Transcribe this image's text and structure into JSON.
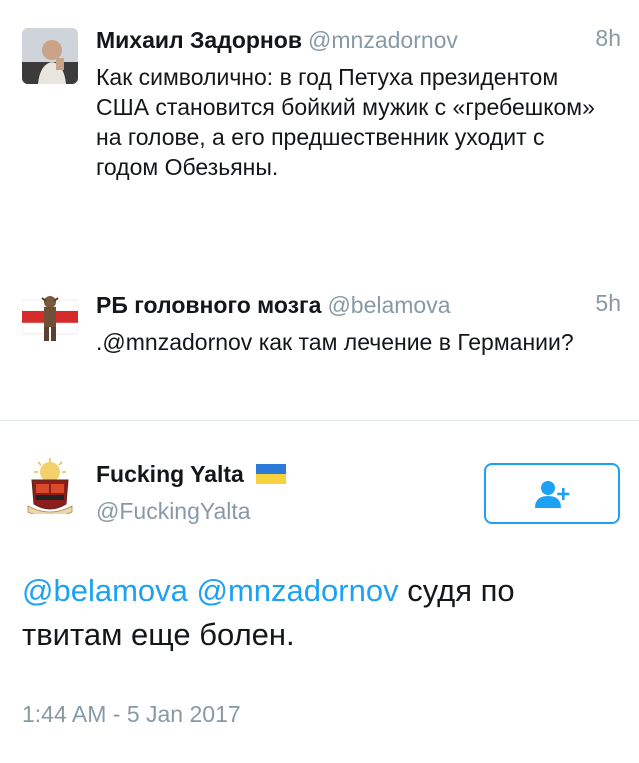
{
  "tweets": [
    {
      "name": "Михаил Задорнов",
      "handle": "@mnzadornov",
      "time": "8h",
      "text": "Как символично: в год Петуха президентом США становится бойкий мужик с «гребешком» на голове, а его предшественник уходит с годом Обезьяны."
    },
    {
      "name": "РБ головного мозга",
      "handle": "@belamova",
      "time": "5h",
      "text": ".@mnzadornov как там лечение в Германии?"
    }
  ],
  "main_tweet": {
    "name": "Fucking Yalta",
    "handle": "@FuckingYalta",
    "mention1": "@belamova",
    "mention2": "@mnzadornov",
    "text_rest": " судя по твитам еще болен.",
    "timestamp": "1:44 AM - 5 Jan 2017",
    "flag_icon": "ukraine-flag-icon",
    "follow_icon": "add-user-icon"
  },
  "colors": {
    "accent": "#1da1f2",
    "muted": "#8899a6",
    "text": "#14171a",
    "divider": "#e1e8ed"
  }
}
